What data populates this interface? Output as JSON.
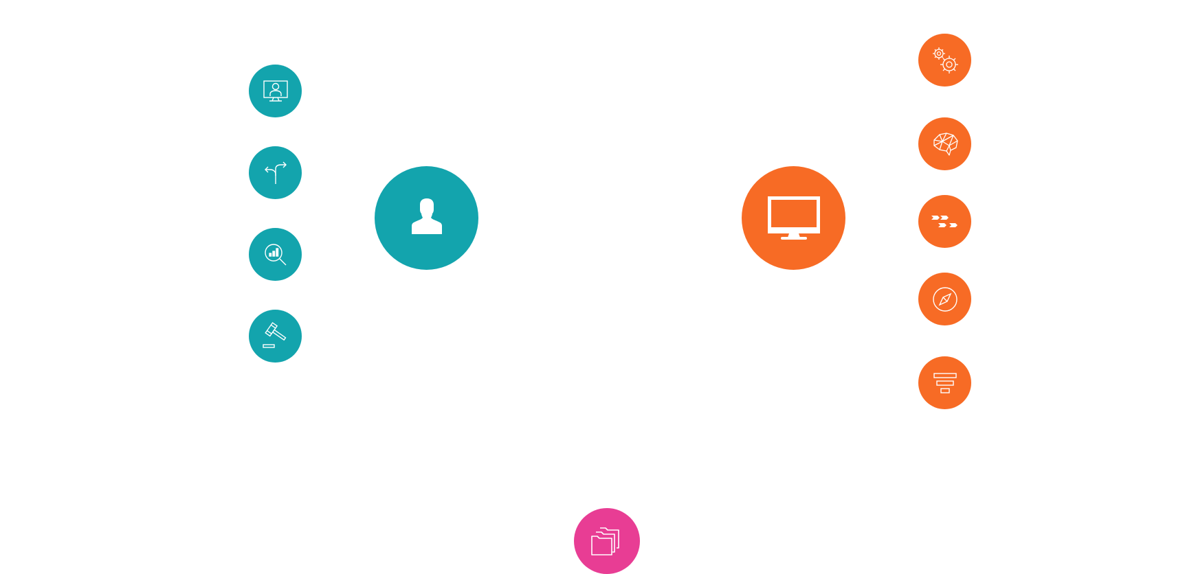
{
  "colors": {
    "teal": "#13A4AD",
    "orange": "#F76B25",
    "pink": "#E83D94",
    "icon": "#FFFFFF",
    "background": "#FFFFFF"
  },
  "hubs": [
    {
      "name": "user-hub",
      "icon": "user-silhouette-icon",
      "color": "teal"
    },
    {
      "name": "computer-hub",
      "icon": "desktop-monitor-icon",
      "color": "orange"
    }
  ],
  "left_nodes": [
    {
      "icon": "online-user-monitor-icon",
      "color": "teal"
    },
    {
      "icon": "split-arrows-decision-icon",
      "color": "teal"
    },
    {
      "icon": "search-analytics-icon",
      "color": "teal"
    },
    {
      "icon": "gavel-icon",
      "color": "teal"
    }
  ],
  "right_nodes": [
    {
      "icon": "gears-icon",
      "color": "orange"
    },
    {
      "icon": "brain-network-icon",
      "color": "orange"
    },
    {
      "icon": "chevron-flow-icon",
      "color": "orange"
    },
    {
      "icon": "compass-icon",
      "color": "orange"
    },
    {
      "icon": "funnel-layers-icon",
      "color": "orange"
    }
  ],
  "bottom_node": {
    "icon": "folders-icon",
    "color": "pink"
  }
}
